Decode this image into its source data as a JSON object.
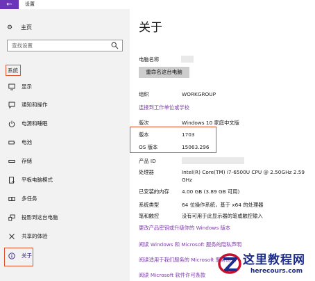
{
  "window": {
    "title": "设置",
    "back_icon": "back-arrow-icon",
    "accent": "#6a35b8"
  },
  "sidebar": {
    "home_label": "主页",
    "search_placeholder": "查找设置",
    "section_label": "系统",
    "items": [
      {
        "label": "显示",
        "icon": "monitor-icon"
      },
      {
        "label": "通知和操作",
        "icon": "notification-icon"
      },
      {
        "label": "电源和睡眠",
        "icon": "power-icon"
      },
      {
        "label": "电池",
        "icon": "battery-icon"
      },
      {
        "label": "存储",
        "icon": "storage-icon"
      },
      {
        "label": "平板电脑模式",
        "icon": "tablet-mode-icon"
      },
      {
        "label": "多任务",
        "icon": "multitask-icon"
      },
      {
        "label": "投影到这台电脑",
        "icon": "project-icon"
      },
      {
        "label": "共享的体验",
        "icon": "share-icon"
      },
      {
        "label": "关于",
        "icon": "info-icon",
        "active": true
      }
    ]
  },
  "main": {
    "title": "关于",
    "pc_name_label": "电脑名称",
    "rename_button": "重命名这台电脑",
    "org_label": "组织",
    "org_value": "WORKGROUP",
    "connect_link": "连接到工作单位或学校",
    "edition_label": "版次",
    "edition_value": "Windows 10 家庭中文版",
    "version_label": "版本",
    "version_value": "1703",
    "os_build_label": "OS 版本",
    "os_build_value": "15063.296",
    "product_id_label": "产品 ID",
    "processor_label": "处理器",
    "processor_value_line1": "Intel(R) Core(TM) i7-6500U CPU @ 2.50GHz   2.59",
    "processor_value_line2": "GHz",
    "ram_label": "已安装的内存",
    "ram_value": "4.00 GB (3.89 GB 可用)",
    "system_type_label": "系统类型",
    "system_type_value": "64 位操作系统，基于 x64 的处理器",
    "pen_touch_label": "笔和触控",
    "pen_touch_value": "没有可用于此显示器的笔或触控输入",
    "links": [
      "更改产品密钥或升级你的 Windows 版本",
      "阅读 Windows 和 Microsoft 服务的隐私声明",
      "阅读适用于我们服务的 Microsoft 服务协议",
      "阅读 Microsoft 软件许可条款"
    ]
  },
  "watermark": {
    "title": "这里教程网",
    "subtitle": "herecours.com",
    "brand_color": "#1d2c8a"
  }
}
